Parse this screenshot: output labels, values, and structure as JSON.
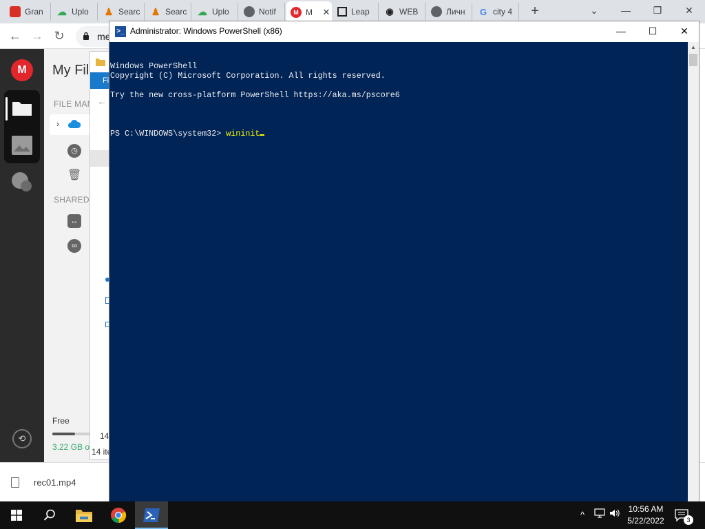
{
  "browser": {
    "tabs": [
      {
        "label": "Gran",
        "icon": "red-app-icon",
        "color": "#d93025"
      },
      {
        "label": "Uplo",
        "icon": "upload-cloud-icon",
        "color": "#34a853"
      },
      {
        "label": "Searc",
        "icon": "person-icon",
        "color": "#e37400"
      },
      {
        "label": "Searc",
        "icon": "person-icon",
        "color": "#e37400"
      },
      {
        "label": "Uplo",
        "icon": "upload-cloud-icon",
        "color": "#34a853"
      },
      {
        "label": "Notif",
        "icon": "globe-icon",
        "color": "#5f6368"
      },
      {
        "label": "M",
        "icon": "mega-icon",
        "color": "#e2262c",
        "active": true
      },
      {
        "label": "Leap",
        "icon": "library-icon",
        "color": "#202124"
      },
      {
        "label": "WEB",
        "icon": "eye-icon",
        "color": "#202124"
      },
      {
        "label": "Личн",
        "icon": "globe-icon",
        "color": "#5f6368"
      },
      {
        "label": "city 4",
        "icon": "google-icon",
        "color": "#4285f4"
      }
    ],
    "tab_close": "✕",
    "new_tab": "+",
    "window_controls": {
      "dropdown": "⌄",
      "minimize": "—",
      "restore": "❐",
      "close": "✕"
    },
    "nav": {
      "back": "←",
      "forward": "→",
      "reload": "↻",
      "lock": "🔒"
    },
    "url": "me"
  },
  "app": {
    "logo": "M",
    "title": "My Fil",
    "section_file_manager": "FILE MAN",
    "section_shared": "SHARED",
    "free_label": "Free",
    "storage_used": "3.22 GB o",
    "storage_fraction": 0.55,
    "sync_icon": "⟲"
  },
  "explorer": {
    "ribbon_label": "Fi",
    "back_arrow": "←",
    "item_count": "14",
    "status": "14 ite"
  },
  "download": {
    "filename": "rec01.mp4"
  },
  "powershell": {
    "title": "Administrator: Windows PowerShell (x86)",
    "title_icon": ">_",
    "minimize": "—",
    "maximize": "☐",
    "close": "✕",
    "lines": [
      "Windows PowerShell",
      "Copyright (C) Microsoft Corporation. All rights reserved.",
      "",
      "Try the new cross-platform PowerShell https://aka.ms/pscore6",
      ""
    ],
    "prompt": "PS C:\\WINDOWS\\system32> ",
    "command": "wininit"
  },
  "taskbar": {
    "clock_time": "10:56 AM",
    "clock_date": "5/22/2022",
    "notification_count": "3",
    "tray_chevron": "^"
  }
}
